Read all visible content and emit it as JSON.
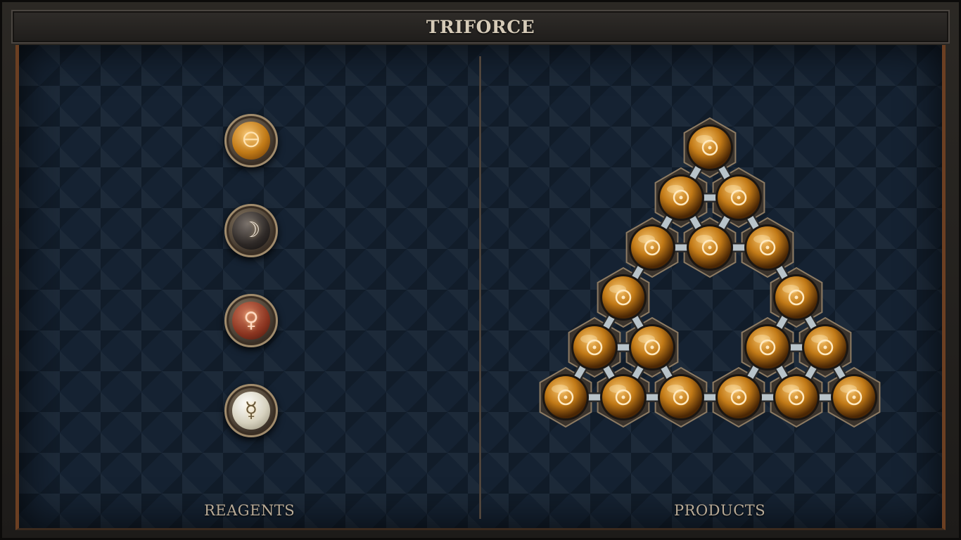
{
  "title": "TRIFORCE",
  "sections": {
    "reagents_label": "REAGENTS",
    "products_label": "PRODUCTS"
  },
  "reagents": [
    {
      "element": "salt",
      "symbol": "🜔",
      "icon": "salt-icon"
    },
    {
      "element": "quicksilver-moon",
      "symbol": "☽",
      "icon": "moon-icon"
    },
    {
      "element": "copper",
      "symbol": "♀",
      "icon": "venus-icon"
    },
    {
      "element": "mercury",
      "symbol": "☿",
      "icon": "mercury-icon"
    }
  ],
  "product": {
    "atom_element": "salt",
    "atom_symbol": "🜔",
    "shape": "triforce",
    "atom_count": 18,
    "bond_count": 24
  },
  "colors": {
    "panel_bg": "#152232",
    "frame_accent": "#6b3f22",
    "salt_orb": "#c17a17",
    "text": "#d6cbb8"
  }
}
